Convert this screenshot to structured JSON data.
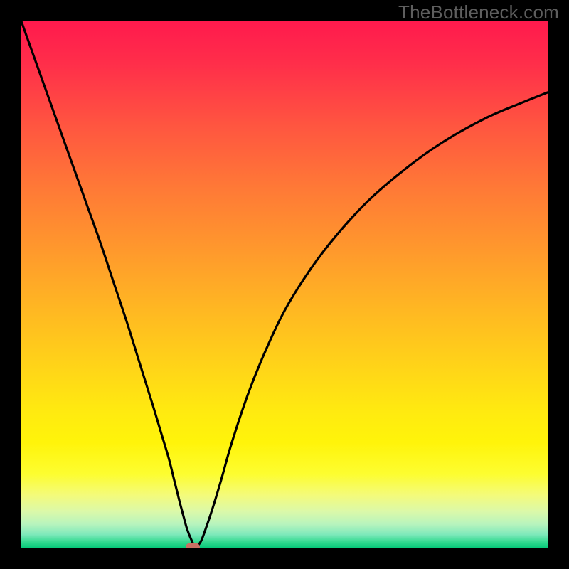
{
  "watermark": "TheBottleneck.com",
  "chart_data": {
    "type": "line",
    "title": "",
    "xlabel": "",
    "ylabel": "",
    "xlim": [
      0,
      100
    ],
    "ylim": [
      0,
      100
    ],
    "grid": false,
    "legend": false,
    "background_gradient": {
      "direction": "vertical",
      "stops": [
        {
          "pos": 0,
          "color": "#ff1a4d"
        },
        {
          "pos": 50,
          "color": "#ffb822"
        },
        {
          "pos": 80,
          "color": "#fff40a"
        },
        {
          "pos": 100,
          "color": "#08c879"
        }
      ]
    },
    "series": [
      {
        "name": "bottleneck-curve",
        "color": "#000000",
        "x": [
          0.0,
          2.5,
          5.0,
          7.5,
          10.0,
          12.5,
          15.0,
          17.5,
          20.0,
          22.5,
          25.0,
          26.5,
          28.0,
          29.0,
          30.0,
          30.8,
          31.5,
          32.3,
          33.0,
          34.0,
          35.0,
          36.5,
          38.0,
          40.0,
          43.0,
          46.0,
          50.0,
          55.0,
          60.0,
          66.0,
          73.0,
          80.0,
          88.0,
          95.0,
          100.0
        ],
        "y": [
          100.0,
          93.0,
          86.0,
          79.0,
          72.0,
          65.0,
          58.0,
          50.5,
          43.0,
          35.0,
          27.0,
          22.0,
          17.0,
          13.0,
          9.0,
          6.0,
          3.5,
          1.5,
          0.3,
          1.0,
          3.5,
          8.0,
          13.0,
          20.0,
          29.0,
          36.5,
          45.0,
          53.0,
          59.5,
          66.0,
          72.0,
          77.0,
          81.5,
          84.5,
          86.5
        ]
      }
    ],
    "marker": {
      "name": "optimal-point",
      "x": 32.5,
      "y": 0,
      "color": "#c97063"
    }
  }
}
